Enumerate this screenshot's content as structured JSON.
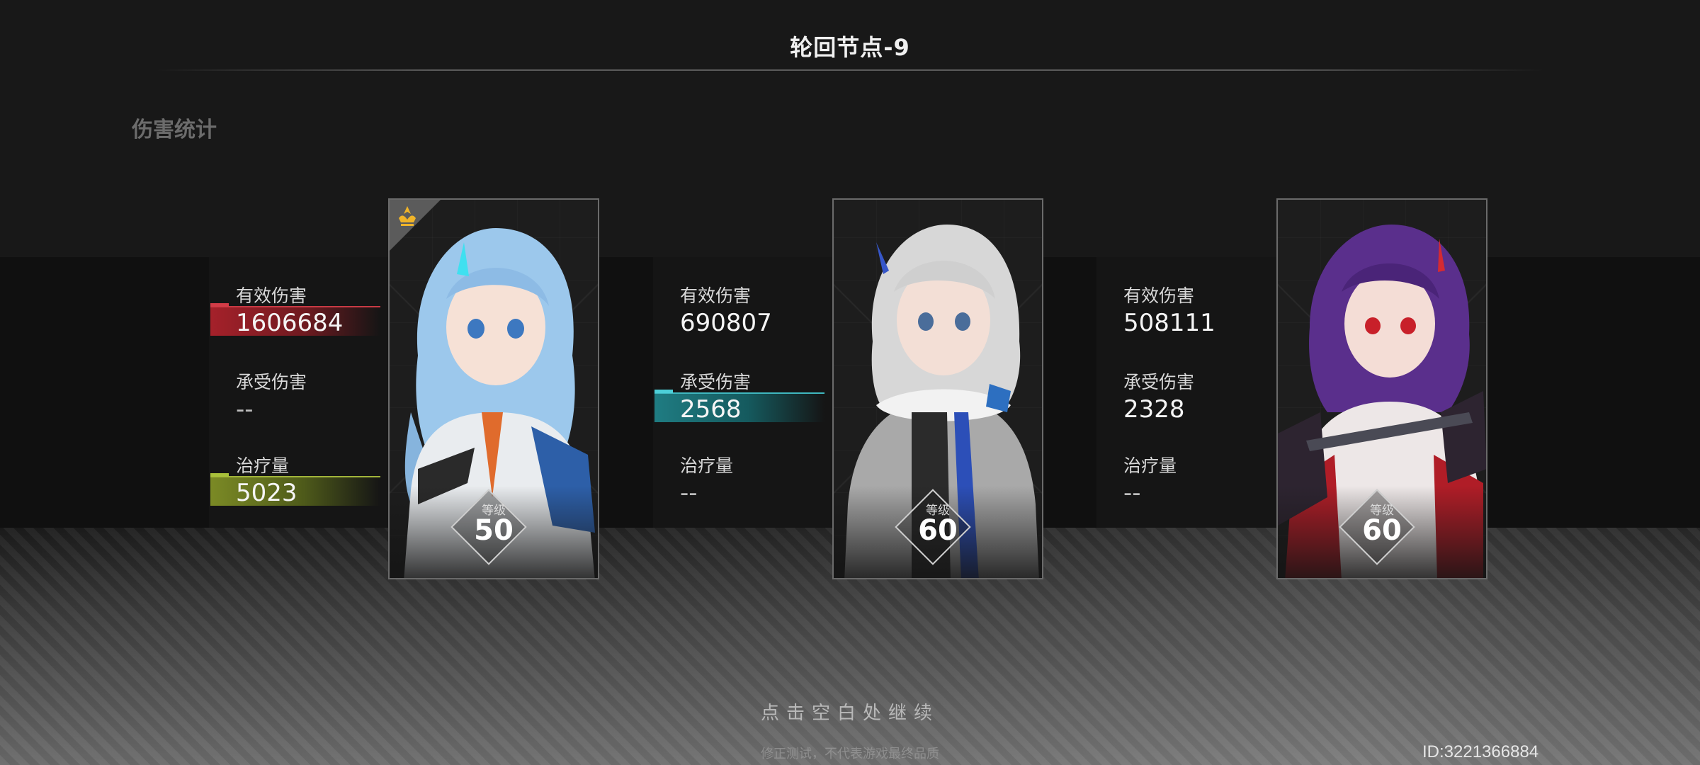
{
  "header": {
    "title": "轮回节点-9",
    "section_label": "伤害统计"
  },
  "characters": [
    {
      "stats": [
        {
          "label": "有效伤害",
          "value": "1606684",
          "highlight": "red"
        },
        {
          "label": "承受伤害",
          "value": "--"
        },
        {
          "label": "治疗量",
          "value": "5023",
          "highlight": "green"
        }
      ],
      "level_label": "等级",
      "level": "50",
      "leader": true,
      "hair_color": "#9cc8ec"
    },
    {
      "stats": [
        {
          "label": "有效伤害",
          "value": "690807"
        },
        {
          "label": "承受伤害",
          "value": "2568",
          "highlight": "teal"
        },
        {
          "label": "治疗量",
          "value": "--"
        }
      ],
      "level_label": "等级",
      "level": "60",
      "leader": false,
      "hair_color": "#d7d7d7"
    },
    {
      "stats": [
        {
          "label": "有效伤害",
          "value": "508111"
        },
        {
          "label": "承受伤害",
          "value": "2328"
        },
        {
          "label": "治疗量",
          "value": "--"
        }
      ],
      "level_label": "等级",
      "level": "60",
      "leader": false,
      "hair_color": "#5a2f8c"
    }
  ],
  "footer": {
    "continue_text": "点击空白处继续",
    "notice_text": "修正测试，不代表游戏最终品质",
    "player_id": "ID:3221366884"
  },
  "colors": {
    "damage_bar": "#a5212a",
    "heal_bar": "#7b8a25",
    "taken_bar": "#1f7c82",
    "leader_icon": "#f0b429"
  },
  "icons": {
    "leader_badge": "leader-crown-icon"
  }
}
